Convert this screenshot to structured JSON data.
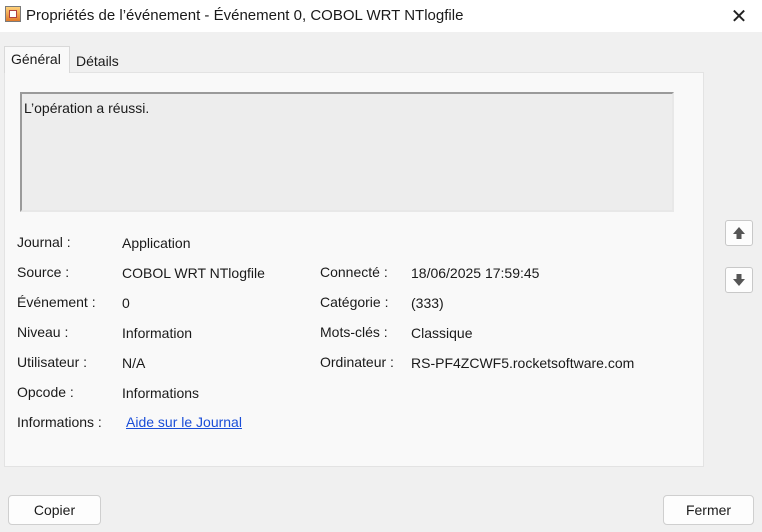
{
  "window": {
    "title": "Propriétés de l’événement - Événement 0, COBOL WRT NTlogfile",
    "close_glyph": "✕"
  },
  "tabs": [
    {
      "label": "Général",
      "active": true
    },
    {
      "label": "Détails",
      "active": false
    }
  ],
  "description": "L’opération a réussi.",
  "fields": {
    "journal": {
      "label": "Journal :",
      "value": "Application"
    },
    "source": {
      "label": "Source :",
      "value": "COBOL WRT NTlogfile"
    },
    "evenement": {
      "label": "Événement :",
      "value": "0"
    },
    "niveau": {
      "label": "Niveau :",
      "value": "Information"
    },
    "utilisateur": {
      "label": "Utilisateur :",
      "value": "N/A"
    },
    "opcode": {
      "label": "Opcode :",
      "value": "Informations"
    },
    "informations": {
      "label": "Informations :",
      "value": "Aide sur le Journal"
    },
    "connecte": {
      "label": "Connecté :",
      "value": "18/06/2025 17:59:45"
    },
    "categorie": {
      "label": "Catégorie :",
      "value": "(333)"
    },
    "motscles": {
      "label": "Mots-clés :",
      "value": "Classique"
    },
    "ordinateur": {
      "label": "Ordinateur :",
      "value": "RS-PF4ZCWF5.rocketsoftware.com"
    }
  },
  "nav": {
    "up_icon": "arrow-up-icon",
    "down_icon": "arrow-down-icon"
  },
  "buttons": {
    "copy": "Copier",
    "close": "Fermer"
  },
  "colors": {
    "link": "#1a4ed8",
    "background": "#f0f0f0"
  }
}
